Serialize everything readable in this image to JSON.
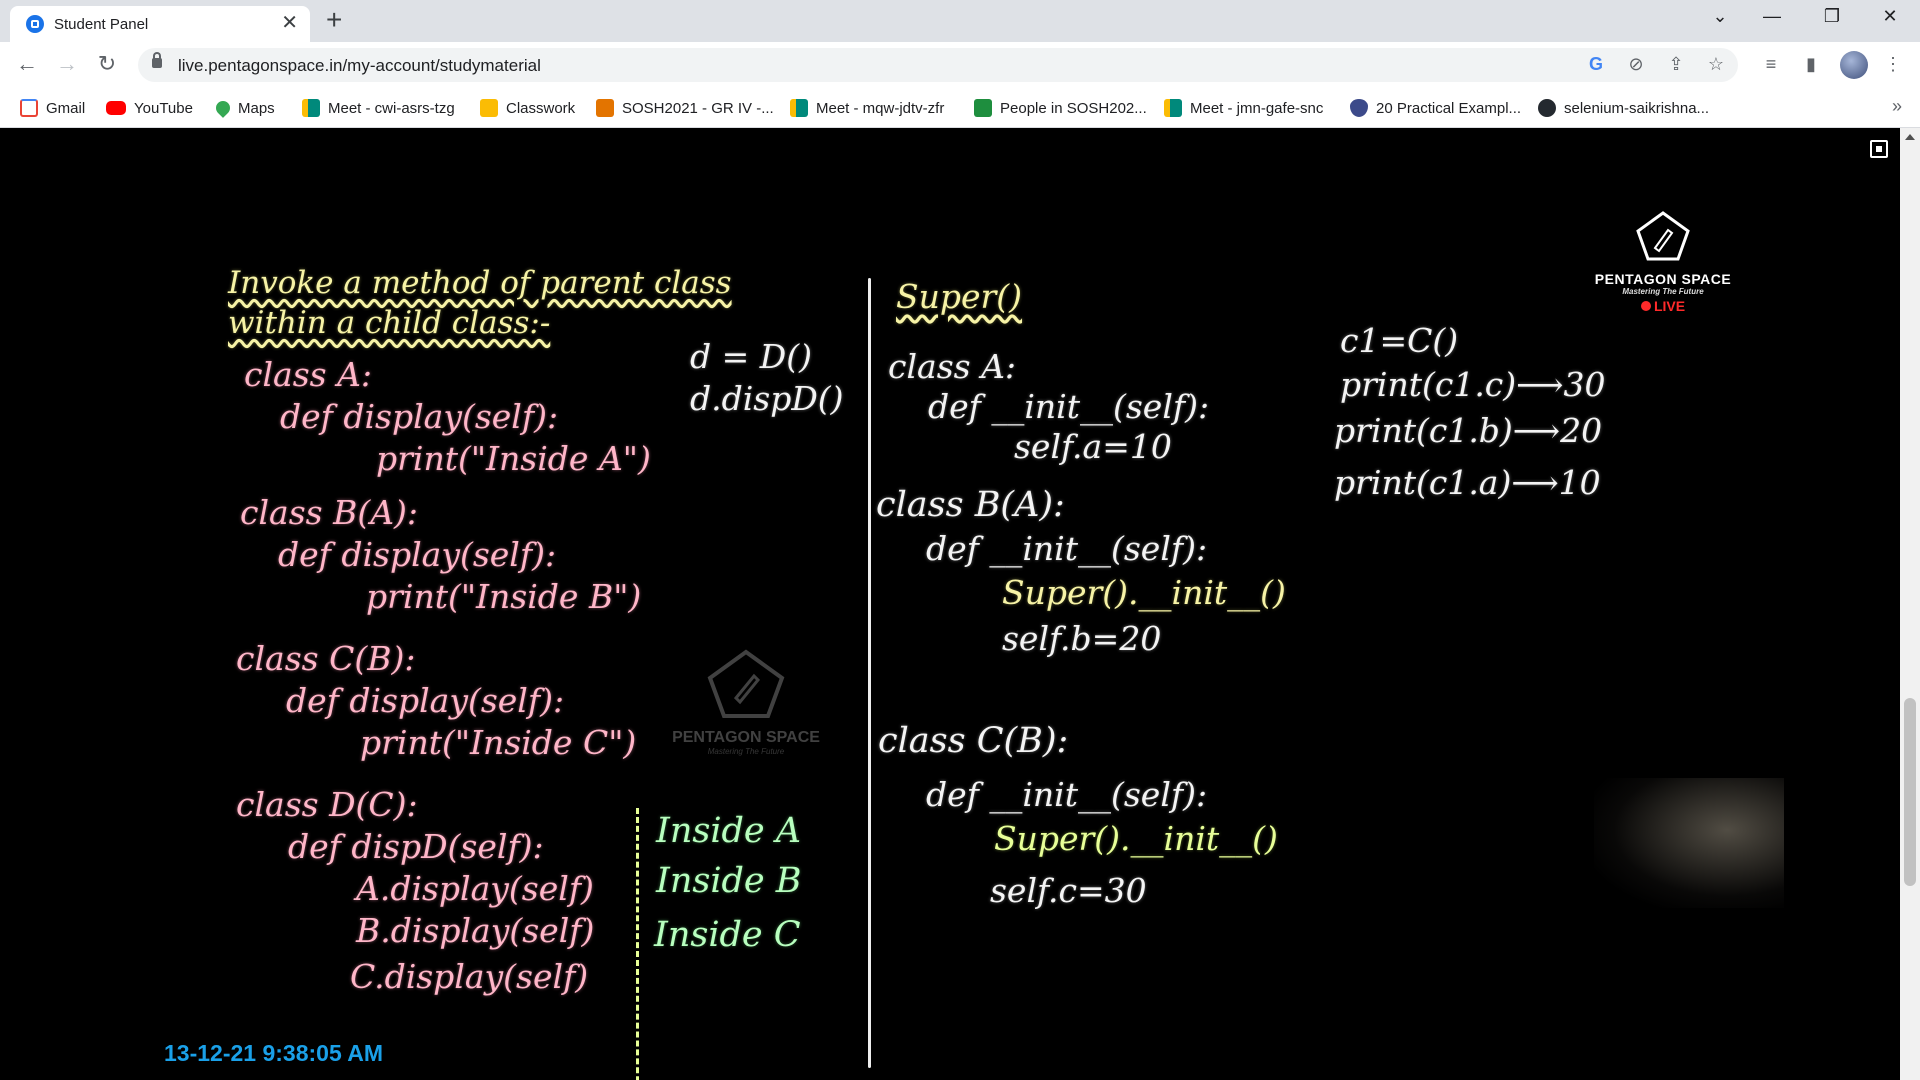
{
  "browser": {
    "tab": {
      "title": "Student Panel",
      "close": "✕"
    },
    "new_tab": "+",
    "window_controls": {
      "tablist": "⌄",
      "minimize": "—",
      "restore": "❐",
      "close": "✕"
    },
    "nav": {
      "back": "←",
      "forward": "→",
      "reload": "↻"
    },
    "url": "live.pentagonspace.in/my-account/studymaterial",
    "omnibox_icons": [
      "google-icon",
      "eye-off-icon",
      "share-icon",
      "star-icon"
    ],
    "toolbar_icons": [
      "media-control-icon",
      "side-panel-icon",
      "profile-avatar",
      "menu-icon"
    ]
  },
  "bookmarks": [
    {
      "label": "Gmail",
      "icon": "gmail-icon",
      "color": "#ea4335"
    },
    {
      "label": "YouTube",
      "icon": "youtube-icon",
      "color": "#ff0000"
    },
    {
      "label": "Maps",
      "icon": "maps-icon",
      "color": "#34a853"
    },
    {
      "label": "Meet - cwi-asrs-tzg",
      "icon": "meet-icon",
      "color": "#00897b"
    },
    {
      "label": "Classwork",
      "icon": "classroom-icon",
      "color": "#fbbc04"
    },
    {
      "label": "SOSH2021 - GR IV -...",
      "icon": "classroom-icon",
      "color": "#e37400"
    },
    {
      "label": "Meet - mqw-jdtv-zfr",
      "icon": "meet-icon",
      "color": "#00897b"
    },
    {
      "label": "People in SOSH202...",
      "icon": "classroom-icon",
      "color": "#1e8e3e"
    },
    {
      "label": "Meet - jmn-gafe-snc",
      "icon": "meet-icon",
      "color": "#00897b"
    },
    {
      "label": "20 Practical Exampl...",
      "icon": "info-shield-icon",
      "color": "#3c4a8a"
    },
    {
      "label": "selenium-saikrishna...",
      "icon": "github-icon",
      "color": "#24292f"
    }
  ],
  "bookmarks_more": "»",
  "video": {
    "left_board": {
      "heading_1": "Invoke a method of parent class",
      "heading_2": "within a child class:-",
      "lines": [
        "class A:",
        "def display(self):",
        "print(\"Inside A\")",
        "class B(A):",
        "def display(self):",
        "print(\"Inside B\")",
        "class C(B):",
        "def display(self):",
        "print(\"Inside C\")",
        "class D(C):",
        "def dispD(self):",
        "A.display(self)",
        "B.display(self)",
        "C.display(self)"
      ],
      "middle": [
        "d = D()",
        "d.dispD()"
      ],
      "outputs": [
        "Inside A",
        "Inside B",
        "Inside C"
      ]
    },
    "right_board": {
      "heading": "Super()",
      "lines": [
        "class A:",
        "def __init__(self):",
        "self.a=10",
        "class B(A):",
        "def __init__(self):",
        "Super().__init__()",
        "self.b=20",
        "class C(B):",
        "def __init__(self):",
        "Super().__init__()",
        "self.c=30"
      ],
      "side": [
        "c1=C()",
        "print(c1.c)⟶30",
        "print(c1.b)⟶20",
        "print(c1.a)⟶10"
      ]
    },
    "logo": {
      "name": "PENTAGON SPACE",
      "tagline": "Mastering The Future",
      "live": "LIVE"
    },
    "watermark": {
      "name": "PENTAGON SPACE",
      "tagline": "Mastering The Future"
    },
    "timestamp": "13-12-21 9:38:05 AM"
  }
}
